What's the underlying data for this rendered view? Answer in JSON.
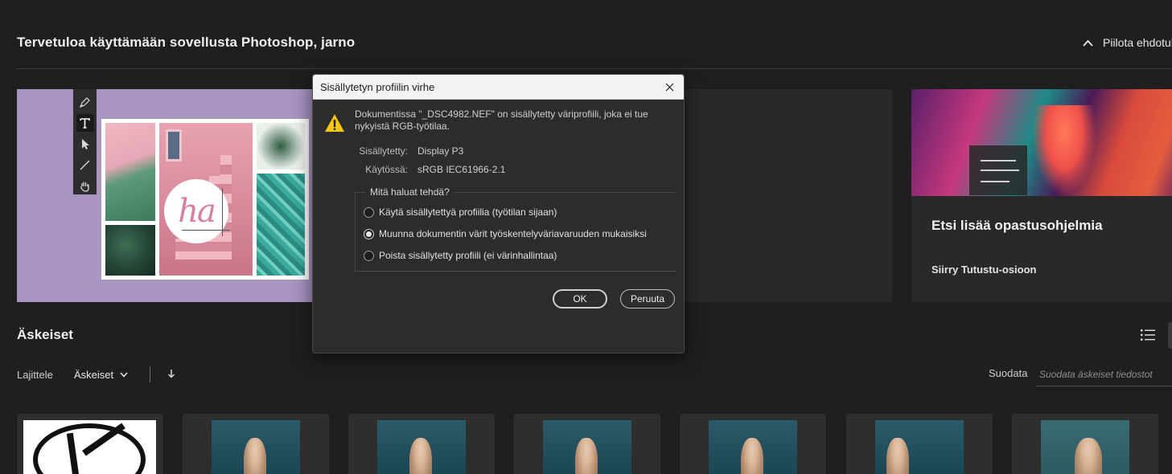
{
  "home": {
    "welcome_title": "Tervetuloa käyttämään sovellusta Photoshop, jarno",
    "hide_suggestions": "Piilota ehdotul"
  },
  "discover_card": {
    "title": "Etsi lisää opastusohjelmia",
    "link": "Siirry Tutustu-osioon"
  },
  "tutorial_card": {
    "collage_text": "ha",
    "tools": [
      "pen-icon",
      "type-icon",
      "select-icon",
      "line-icon",
      "hand-icon"
    ]
  },
  "recent": {
    "title": "Äskeiset",
    "sort_label": "Lajittele",
    "sort_value": "Äskeiset",
    "filter_label": "Suodata",
    "filter_placeholder": "Suodata äskeiset tiedostot",
    "thumbnails": [
      "logo",
      "portrait",
      "portrait",
      "portrait",
      "portrait",
      "portrait",
      "portrait"
    ]
  },
  "dialog": {
    "title": "Sisällytetyn profiilin virhe",
    "message": "Dokumentissa \"_DSC4982.NEF\" on sisällytetty väriprofiili, joka ei tue nykyistä RGB-työtilaa.",
    "embedded_label": "Sisällytetty:",
    "embedded_value": "Display P3",
    "working_label": "Käytössä:",
    "working_value": "sRGB IEC61966-2.1",
    "question": "Mitä haluat tehdä?",
    "options": [
      "Käytä sisällytettyä profiilia (työtilan sijaan)",
      "Muunna dokumentin värit työskentelyväriavaruuden mukaisiksi",
      "Poista sisällytetty profiili (ei värinhallintaa)"
    ],
    "selected_option_index": 1,
    "ok_label": "OK",
    "cancel_label": "Peruuta"
  },
  "colors": {
    "background": "#1f1f1f",
    "card": "#292929",
    "tutorial_bg": "#a995c2",
    "dialog_bg": "#2c2c2c",
    "dialog_titlebar": "#f3f3f3",
    "warning": "#f5c518"
  }
}
